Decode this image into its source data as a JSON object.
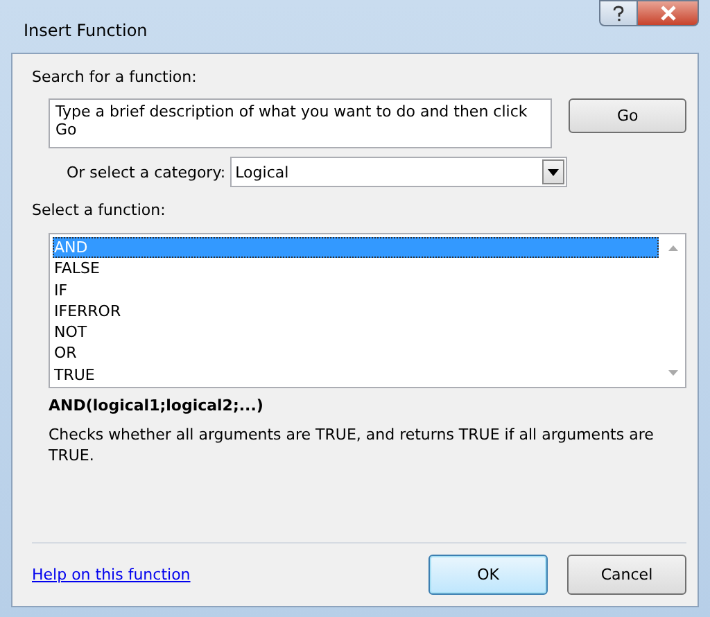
{
  "window": {
    "title": "Insert Function"
  },
  "search": {
    "label": "Search for a function:",
    "placeholder": "Type a brief description of what you want to do and then click Go",
    "button": "Go"
  },
  "category": {
    "label": "Or select a category:",
    "value": "Logical"
  },
  "functions": {
    "label": "Select a function:",
    "items": [
      {
        "name": "AND",
        "selected": true
      },
      {
        "name": "FALSE",
        "selected": false
      },
      {
        "name": "IF",
        "selected": false
      },
      {
        "name": "IFERROR",
        "selected": false
      },
      {
        "name": "NOT",
        "selected": false
      },
      {
        "name": "OR",
        "selected": false
      },
      {
        "name": "TRUE",
        "selected": false
      }
    ]
  },
  "signature": "AND(logical1;logical2;...)",
  "description": "Checks whether all arguments are TRUE, and returns TRUE if all arguments are TRUE.",
  "help_link": "Help on this function",
  "buttons": [
    "OK",
    "Cancel"
  ]
}
